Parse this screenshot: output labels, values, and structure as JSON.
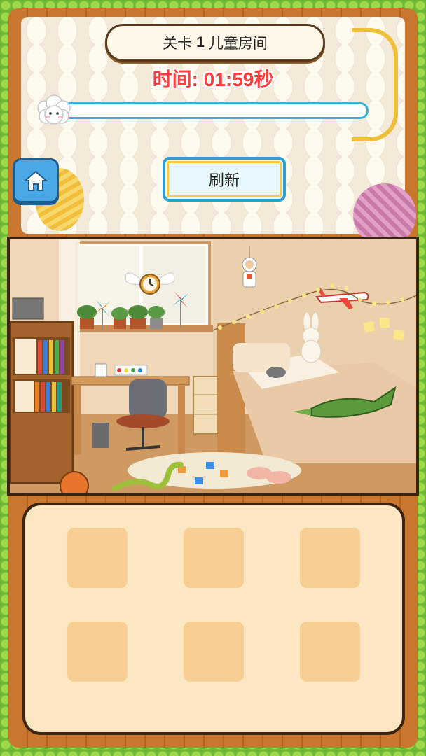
{
  "header": {
    "level_prefix": "关卡",
    "level_number": "1",
    "level_name": "儿童房间"
  },
  "timer": {
    "text": "时间: 01:59秒"
  },
  "progress": {
    "fraction": 0.0
  },
  "buttons": {
    "home_icon": "home-icon",
    "refresh_label": "刷新"
  },
  "scene": {
    "description_icon": "kids-room-scene"
  },
  "tray": {
    "slots": [
      "",
      "",
      "",
      "",
      "",
      ""
    ]
  },
  "colors": {
    "timer": "#ff3d3d",
    "progress_border": "#38b0d8",
    "home_button": "#4aa8e6",
    "refresh_border": "#2b9fd2"
  }
}
